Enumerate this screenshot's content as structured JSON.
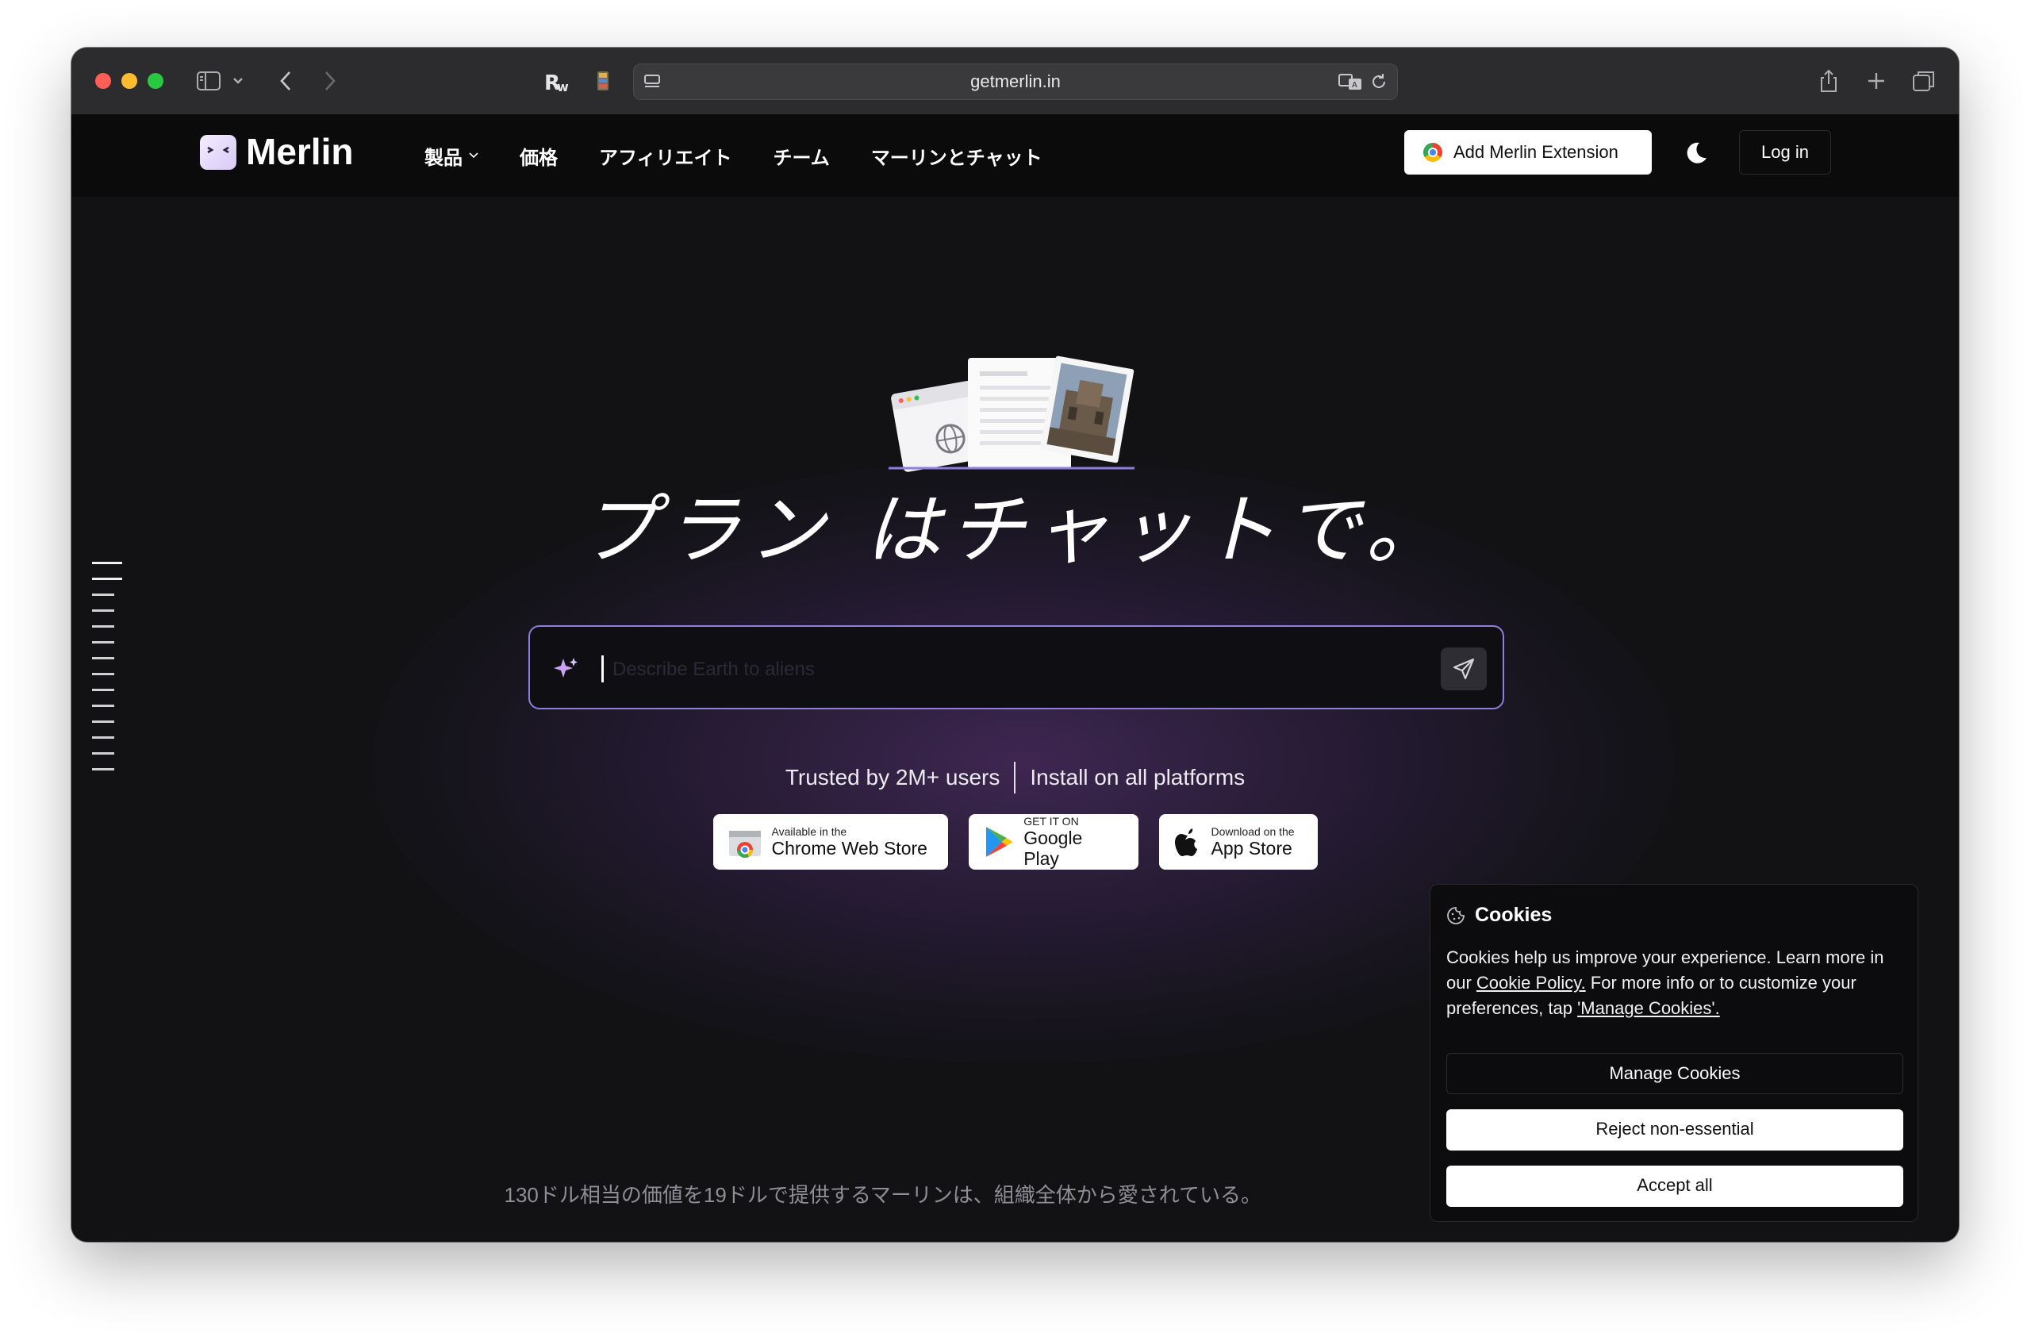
{
  "browser": {
    "url": "getmerlin.in",
    "icons": [
      "sidebar-icon",
      "chevron-down-icon",
      "back-icon",
      "forward-icon",
      "readwise-icon",
      "extension-icon",
      "reader-icon",
      "translate-icon",
      "reload-icon",
      "share-icon",
      "new-tab-icon",
      "tabs-overview-icon"
    ]
  },
  "nav": {
    "logo": "Merlin",
    "links": [
      "製品",
      "価格",
      "アフィリエイト",
      "チーム",
      "マーリンとチャット"
    ],
    "extension_button": "Add Merlin Extension",
    "login": "Log in"
  },
  "hero": {
    "headline": "プラン はチャットで。",
    "input_placeholder": "Describe Earth to aliens",
    "trust": "Trusted by 2M+ users",
    "platforms": "Install on all platforms",
    "stores": [
      {
        "small": "Available in the",
        "big": "Chrome Web Store"
      },
      {
        "small": "GET IT ON",
        "big": "Google Play"
      },
      {
        "small": "Download on the",
        "big": "App Store"
      }
    ],
    "tagline": "130ドル相当の価値を19ドルで提供するマーリンは、組織全体から愛されている。"
  },
  "cookies": {
    "title": "Cookies",
    "text_before": "Cookies help us improve your experience. Learn more in our ",
    "policy_link": "Cookie Policy.",
    "text_middle": " For more info or to customize your preferences, tap ",
    "manage_link": "'Manage Cookies'.",
    "manage": "Manage Cookies",
    "reject": "Reject non-essential",
    "accept": "Accept all"
  },
  "colors": {
    "accent": "#8d7ee0",
    "background": "#121214",
    "nav_background": "#0b0b0c"
  }
}
